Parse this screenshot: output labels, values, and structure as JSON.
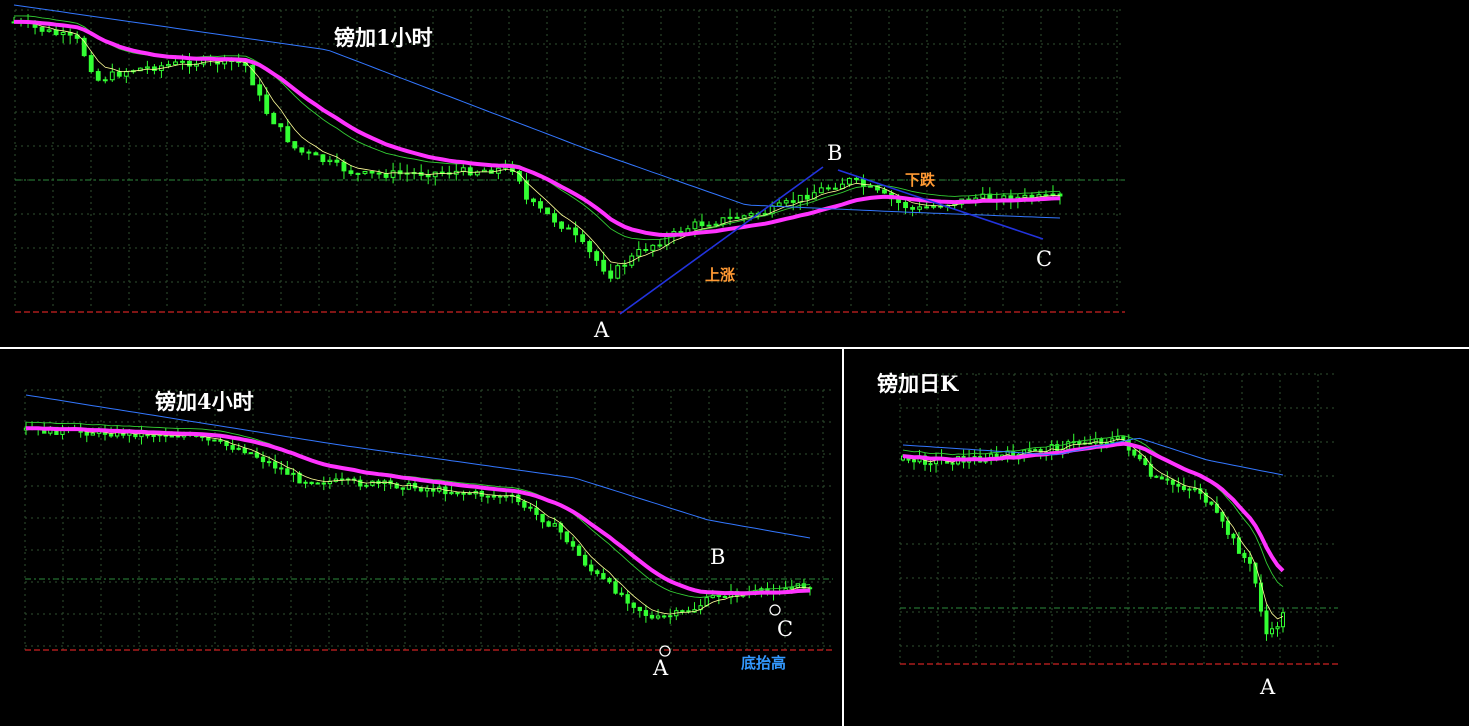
{
  "colors": {
    "background": "#000000",
    "grid": "#2f4f2f",
    "candle": "#33ff33",
    "ma_fast": "#ffff99",
    "ma_mid": "#33cc33",
    "ma_long": "#3377ff",
    "ma_main": "#ff33ff",
    "level_green": "#2d8a3b",
    "level_red": "#cc2222",
    "trend_line": "#2233dd",
    "annotation_orange": "#ff9933",
    "annotation_blue": "#3399ff",
    "divider": "#ffffff"
  },
  "chart_data": [
    {
      "type": "candlestick",
      "title": "镑加1小时",
      "grid": true,
      "legend": "none",
      "points": [
        "A",
        "B",
        "C"
      ],
      "annotations": [
        "上涨",
        "下跌"
      ]
    },
    {
      "type": "candlestick",
      "title": "镑加4小时",
      "grid": true,
      "legend": "none",
      "points": [
        "A",
        "B",
        "C"
      ],
      "annotations": [
        "底抬高"
      ]
    },
    {
      "type": "candlestick",
      "title": "镑加日K",
      "grid": true,
      "legend": "none",
      "points": [
        "A"
      ],
      "annotations": []
    }
  ]
}
